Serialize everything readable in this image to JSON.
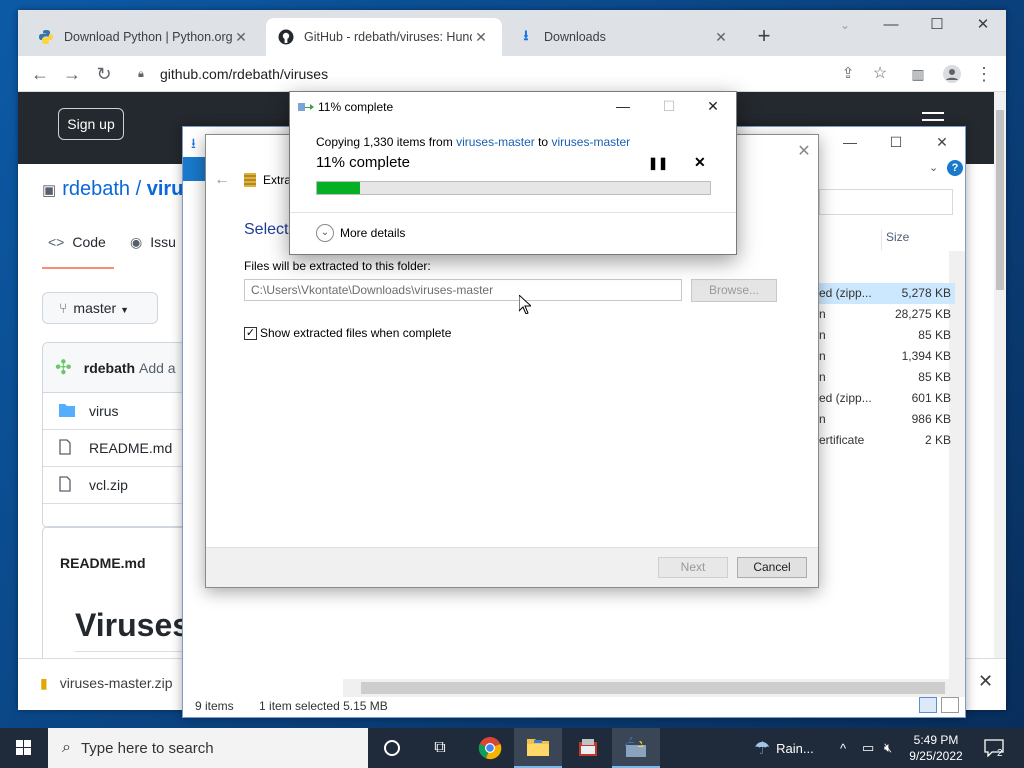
{
  "browser": {
    "tabs": [
      {
        "label": "Download Python | Python.org",
        "icon": "python-icon"
      },
      {
        "label": "GitHub - rdebath/viruses: Hundr",
        "icon": "github-icon"
      },
      {
        "label": "Downloads",
        "icon": "download-icon"
      }
    ],
    "url": "github.com/rdebath/viruses"
  },
  "github": {
    "signup": "Sign up",
    "owner": "rdebath",
    "separator": "/",
    "repo": "viru",
    "tabs": {
      "code": "Code",
      "issues": "Issu"
    },
    "branch": "master",
    "commit_author": "rdebath",
    "commit_msg": "Add a",
    "files": [
      "virus",
      "README.md",
      "vcl.zip"
    ],
    "readme_label": "README.md",
    "readme_heading": "Viruses"
  },
  "download_bar": {
    "file": "viruses-master.zip"
  },
  "explorer": {
    "column_size": "Size",
    "rows": [
      {
        "type": "ed (zipp...",
        "size": "5,278 KB",
        "selected": true
      },
      {
        "type": "n",
        "size": "28,275 KB"
      },
      {
        "type": "n",
        "size": "85 KB"
      },
      {
        "type": "n",
        "size": "1,394 KB"
      },
      {
        "type": "n",
        "size": "85 KB"
      },
      {
        "type": "ed (zipp...",
        "size": "601 KB"
      },
      {
        "type": "n",
        "size": "986 KB"
      },
      {
        "type": "ertificate",
        "size": "2 KB"
      }
    ],
    "status_items": "9 items",
    "status_selected": "1 item selected  5.15 MB"
  },
  "wizard": {
    "title": "Extra",
    "heading": "Select",
    "label": "Files will be extracted to this folder:",
    "path": "C:\\Users\\Vkontate\\Downloads\\viruses-master",
    "browse": "Browse...",
    "checkbox": "Show extracted files when complete",
    "checked": true,
    "next": "Next",
    "cancel": "Cancel"
  },
  "copy_dialog": {
    "title": "11% complete",
    "line_prefix": "Copying 1,330 items from ",
    "source": "viruses-master",
    "to": " to ",
    "dest": "viruses-master",
    "percent_text": "11% complete",
    "progress": 0.11,
    "more": "More details"
  },
  "taskbar": {
    "search": "Type here to search",
    "weather": "Rain...",
    "time": "5:49 PM",
    "date": "9/25/2022",
    "notifications": "2"
  },
  "colors": {
    "accent": "#0969da",
    "progress": "#06b025",
    "taskbar": "#1f2b3a"
  }
}
